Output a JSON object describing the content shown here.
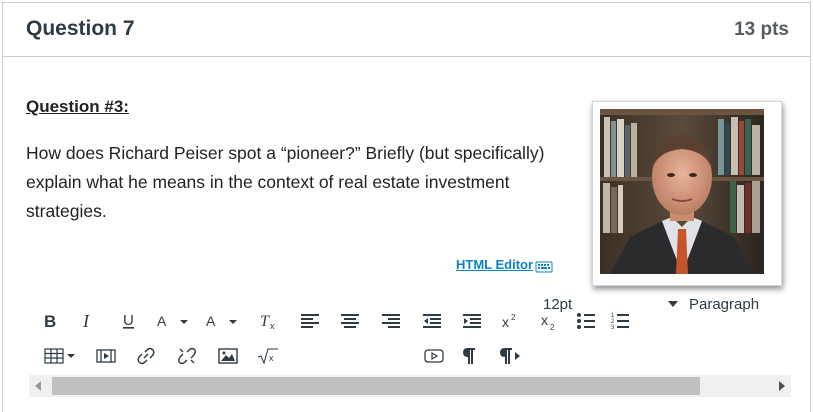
{
  "question": {
    "title": "Question 7",
    "points": "13 pts",
    "subheading": "Question #3:",
    "text": "How does Richard Peiser spot a “pioneer?”   Briefly (but specifically) explain what he means in the context of real estate investment strategies.",
    "photo_icon": "portrait-photo"
  },
  "editor": {
    "html_editor_label": "HTML Editor",
    "font_size": "12pt",
    "block_format": "Paragraph"
  },
  "toolbar_icons": {
    "row1": [
      "bold-icon",
      "italic-icon",
      "underline-icon",
      "text-color-icon",
      "background-color-icon",
      "clear-formatting-icon",
      "align-left-icon",
      "align-center-icon",
      "align-right-icon",
      "outdent-icon",
      "indent-icon",
      "superscript-icon",
      "subscript-icon",
      "bullet-list-icon",
      "numbered-list-icon"
    ],
    "row2": [
      "table-icon",
      "media-icon",
      "link-icon",
      "unlink-icon",
      "image-icon",
      "math-equation-icon",
      "embed-icon",
      "ltr-icon",
      "rtl-icon"
    ]
  },
  "colors": {
    "border": "#c7cdd1",
    "link": "#0a84c6",
    "text": "#2d3b45"
  }
}
